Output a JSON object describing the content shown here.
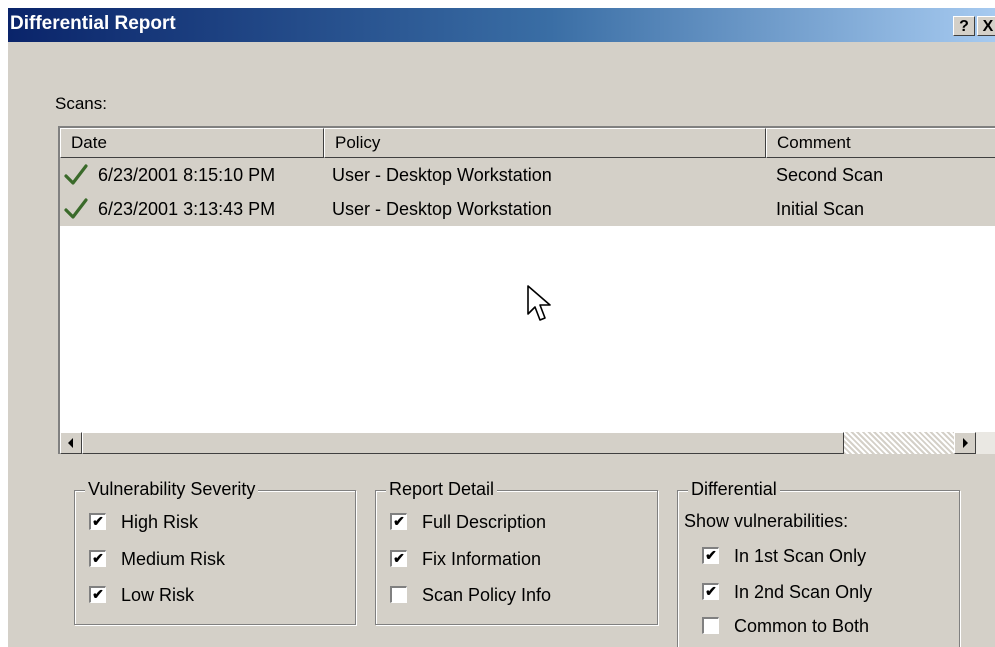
{
  "window": {
    "title": "Differential Report",
    "help_label": "?",
    "close_label": "X"
  },
  "scans": {
    "label": "Scans:",
    "columns": [
      "Date",
      "Policy",
      "Comment"
    ],
    "rows": [
      {
        "date": "6/23/2001 8:15:10 PM",
        "policy": "User - Desktop Workstation",
        "comment": "Second Scan",
        "icon": "check-icon"
      },
      {
        "date": "6/23/2001 3:13:43 PM",
        "policy": "User - Desktop Workstation",
        "comment": "Initial Scan",
        "icon": "check-icon"
      }
    ]
  },
  "severity": {
    "title": "Vulnerability Severity",
    "options": [
      {
        "label": "High Risk",
        "checked": true
      },
      {
        "label": "Medium Risk",
        "checked": true
      },
      {
        "label": "Low Risk",
        "checked": true
      }
    ]
  },
  "report_detail": {
    "title": "Report Detail",
    "options": [
      {
        "label": "Full Description",
        "checked": true
      },
      {
        "label": "Fix Information",
        "checked": true
      },
      {
        "label": "Scan Policy Info",
        "checked": false
      }
    ]
  },
  "differential": {
    "title": "Differential",
    "subtitle": "Show vulnerabilities:",
    "options": [
      {
        "label": "In 1st Scan Only",
        "checked": true
      },
      {
        "label": "In 2nd Scan Only",
        "checked": true
      },
      {
        "label": "Common to Both",
        "checked": false
      }
    ]
  },
  "colors": {
    "face": "#d4d0c8",
    "title_start": "#0a246a",
    "title_end": "#a6caf0",
    "check": "#3a6a2a"
  }
}
